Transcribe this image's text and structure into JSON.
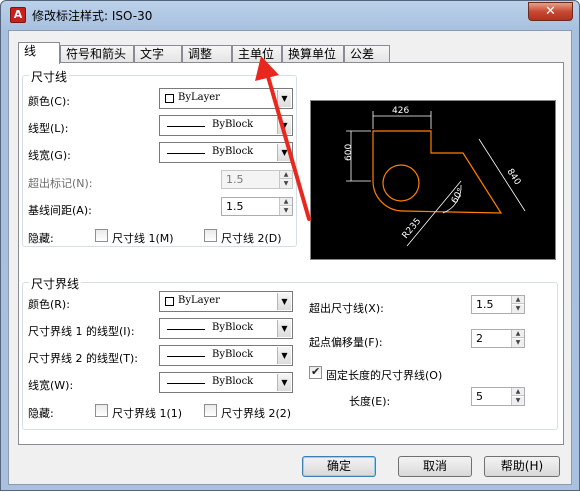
{
  "window": {
    "title": "修改标注样式: ISO-30",
    "close_symbol": "✕",
    "app_letter": "A"
  },
  "tabs": [
    "线",
    "符号和箭头",
    "文字",
    "调整",
    "主单位",
    "换算单位",
    "公差"
  ],
  "dim_lines": {
    "group_title": "尺寸线",
    "color_label": "颜色(C):",
    "color_value": "ByLayer",
    "linetype_label": "线型(L):",
    "linetype_value": "ByBlock",
    "lineweight_label": "线宽(G):",
    "lineweight_value": "ByBlock",
    "extend_label": "超出标记(N):",
    "extend_value": "1.5",
    "baseline_label": "基线间距(A):",
    "baseline_value": "1.5",
    "suppress_label": "隐藏:",
    "suppress_1": "尺寸线 1(M)",
    "suppress_2": "尺寸线 2(D)"
  },
  "ext_lines": {
    "group_title": "尺寸界线",
    "color_label": "颜色(R):",
    "color_value": "ByLayer",
    "linetype1_label": "尺寸界线 1 的线型(I):",
    "linetype1_value": "ByBlock",
    "linetype2_label": "尺寸界线 2 的线型(T):",
    "linetype2_value": "ByBlock",
    "lineweight_label": "线宽(W):",
    "lineweight_value": "ByBlock",
    "suppress_label": "隐藏:",
    "suppress_1": "尺寸界线 1(1)",
    "suppress_2": "尺寸界线 2(2)",
    "extend_beyond_label": "超出尺寸线(X):",
    "extend_beyond_value": "1.5",
    "offset_label": "起点偏移量(F):",
    "offset_value": "2",
    "fixed_length_label": "固定长度的尺寸界线(O)",
    "fixed_length_checked": true,
    "length_label": "长度(E):",
    "length_value": "5"
  },
  "preview": {
    "dim_top": "426",
    "dim_left": "600",
    "dim_right": "840",
    "dim_angle": "60°",
    "dim_radius": "R235"
  },
  "buttons": {
    "ok": "确定",
    "cancel": "取消",
    "help": "帮助(H)"
  },
  "colors": {
    "preview_bg": "#000000",
    "geometry": "#ff7f00",
    "dims": "#ffffff",
    "annotation_arrow": "#e8281e"
  }
}
